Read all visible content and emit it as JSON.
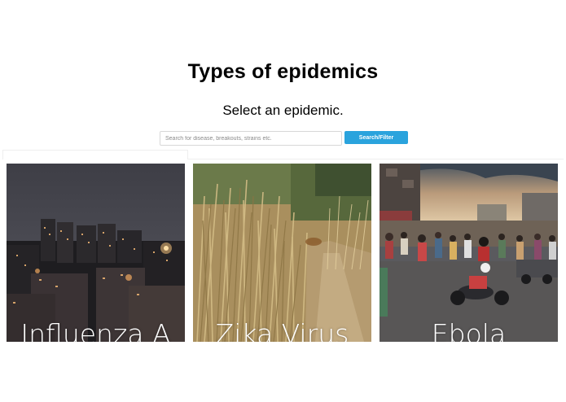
{
  "header": {
    "title": "Types of epidemics",
    "subtitle": "Select an epidemic."
  },
  "search": {
    "placeholder": "Search for disease, breakouts, strains etc.",
    "value": "",
    "button_label": "Search/Filter",
    "button_color": "#2aa3dd"
  },
  "cards": [
    {
      "label": "Influenza A",
      "image": "night-city-skyline-photo"
    },
    {
      "label": "Zika Virus",
      "image": "tall-dry-grass-path-photo"
    },
    {
      "label": "Ebola",
      "image": "crowded-street-market-photo"
    }
  ]
}
